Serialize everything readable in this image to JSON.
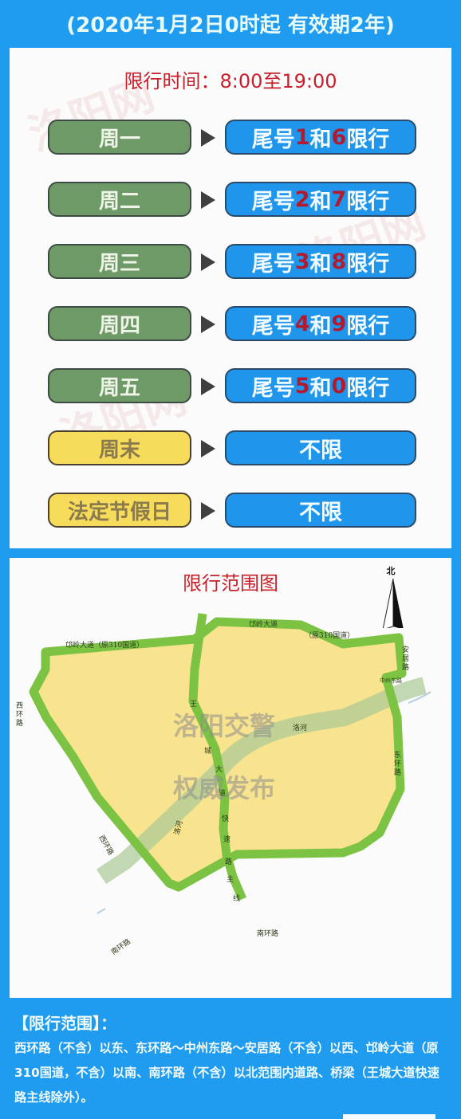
{
  "header": {
    "validity": "(2020年1月2日0时起 有效期2年)"
  },
  "schedule": {
    "time_title": "限行时间：8:00至19:00",
    "rows": [
      {
        "day": "周一",
        "type": "weekday",
        "prefix": "尾号",
        "num1": "1",
        "mid": "和",
        "num2": "6",
        "suffix": "限行"
      },
      {
        "day": "周二",
        "type": "weekday",
        "prefix": "尾号",
        "num1": "2",
        "mid": "和",
        "num2": "7",
        "suffix": "限行"
      },
      {
        "day": "周三",
        "type": "weekday",
        "prefix": "尾号",
        "num1": "3",
        "mid": "和",
        "num2": "8",
        "suffix": "限行"
      },
      {
        "day": "周四",
        "type": "weekday",
        "prefix": "尾号",
        "num1": "4",
        "mid": "和",
        "num2": "9",
        "suffix": "限行"
      },
      {
        "day": "周五",
        "type": "weekday",
        "prefix": "尾号",
        "num1": "5",
        "mid": "和",
        "num2": "0",
        "suffix": "限行"
      },
      {
        "day": "周末",
        "type": "weekend",
        "rule": "不限"
      },
      {
        "day": "法定节假日",
        "type": "holiday",
        "rule": "不限"
      }
    ],
    "arrow_icon": "triangle-right-icon"
  },
  "map": {
    "title": "限行范围图",
    "compass_label": "北",
    "watermark_line1": "洛阳交警",
    "watermark_line2": "权威发布",
    "roads": {
      "north_left": "邙岭大道（原310国道）",
      "north_right_1": "邙岭大道",
      "north_right_2": "（原310国道）",
      "anju": "安居路",
      "zhongzhou": "中州东路",
      "east": "东环路",
      "west_top": "西环路",
      "west_bottom": "西环路",
      "south_right": "南环路",
      "south_left": "南环路",
      "river": "洛河",
      "river2": "洛河",
      "wangcheng": [
        "王",
        "城",
        "大",
        "道",
        "快",
        "速",
        "路",
        "主",
        "线"
      ]
    }
  },
  "colors": {
    "background": "#1f9bf0",
    "weekday_box": "#6e9a67",
    "weekend_box": "#f7dc5c",
    "rule_box": "#1f96ec",
    "highlight_number": "#b41a2e",
    "title_red": "#c8202a",
    "road_green": "#7cc243",
    "area_yellow": "#f8e38e"
  },
  "scope": {
    "title": "【限行范围】：",
    "text": "西环路（不含）以东、东环路～中州东路～安居路（不含）以西、邙岭大道（原310国道，不含）以南、南环路（不含）以北范围内道路、桥梁（王城大道快速路主线除外）。"
  }
}
